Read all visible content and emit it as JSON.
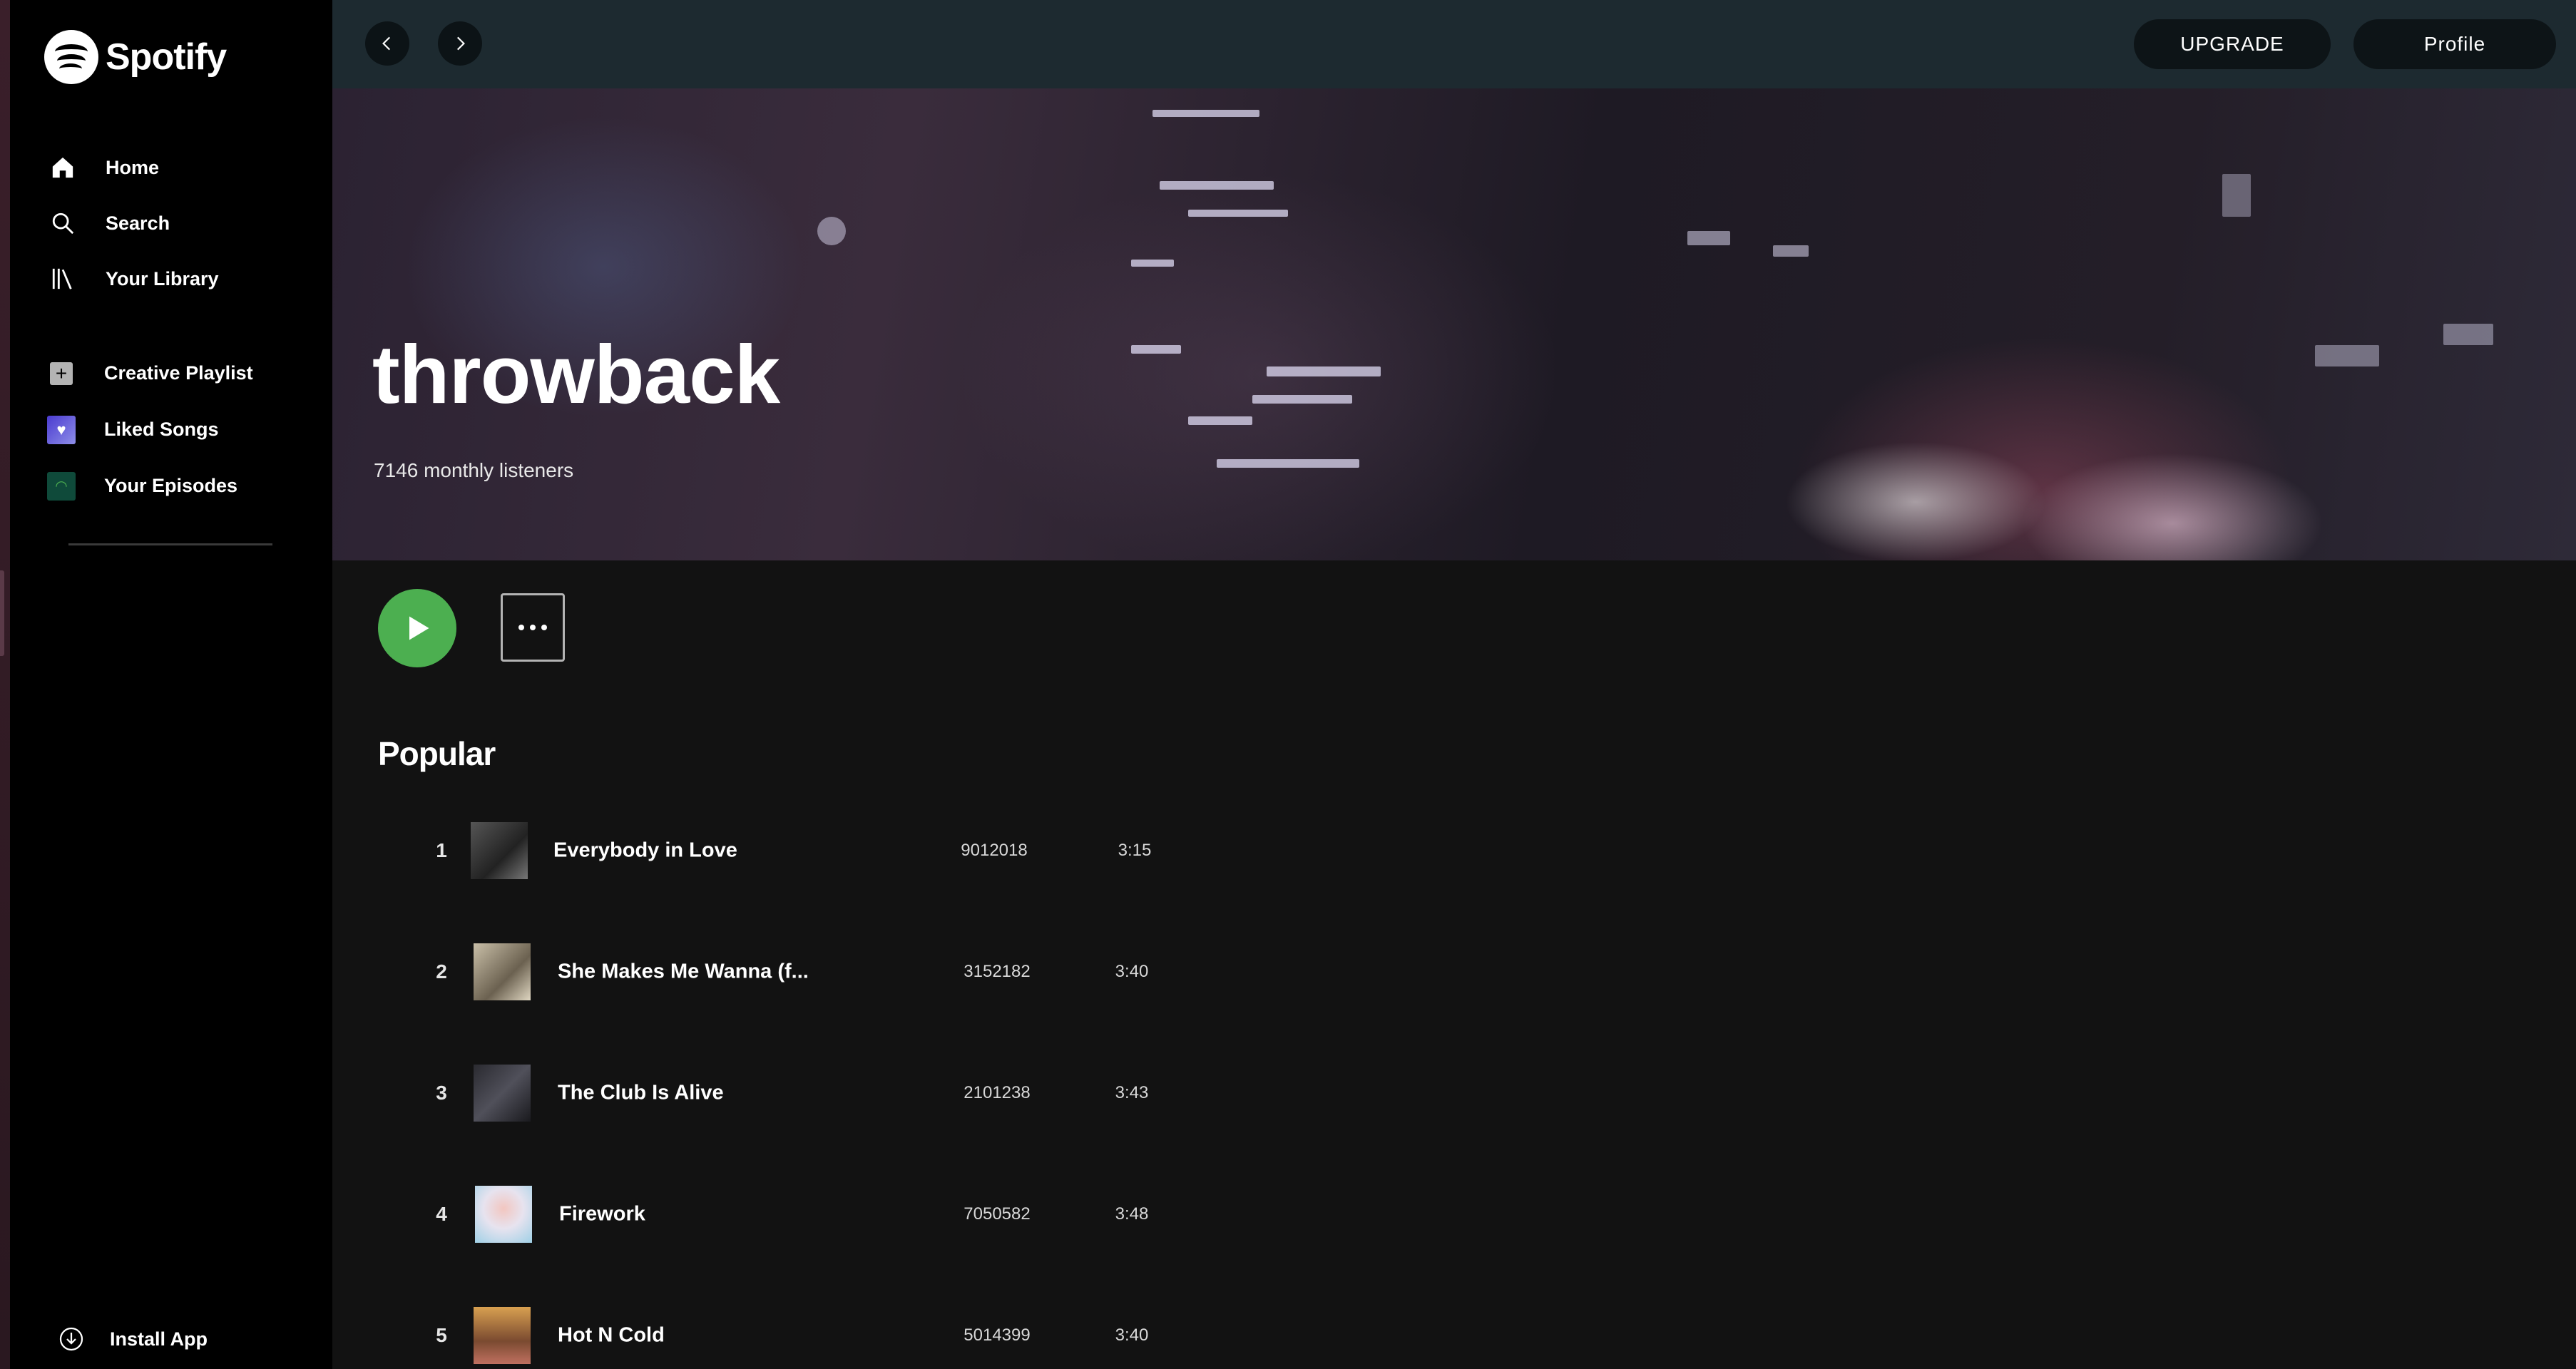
{
  "brand": {
    "name": "Spotify"
  },
  "nav": {
    "items": [
      {
        "label": "Home",
        "icon": "home-icon"
      },
      {
        "label": "Search",
        "icon": "search-icon"
      },
      {
        "label": "Your Library",
        "icon": "library-icon"
      }
    ],
    "secondary": [
      {
        "label": "Creative Playlist",
        "icon": "plus-icon"
      },
      {
        "label": "Liked Songs",
        "icon": "heart-icon"
      },
      {
        "label": "Your Episodes",
        "icon": "podcast-icon"
      }
    ],
    "install_label": "Install App"
  },
  "topbar": {
    "upgrade_label": "UPGRADE",
    "profile_label": "Profile"
  },
  "hero": {
    "title": "throwback",
    "listeners": "7146 monthly listeners"
  },
  "section": {
    "title": "Popular"
  },
  "tracks": [
    {
      "num": "1",
      "title": "Everybody in Love",
      "plays": "9012018",
      "duration": "3:15"
    },
    {
      "num": "2",
      "title": "She Makes Me Wanna (f...",
      "plays": "3152182",
      "duration": "3:40"
    },
    {
      "num": "3",
      "title": "The Club Is Alive",
      "plays": "2101238",
      "duration": "3:43"
    },
    {
      "num": "4",
      "title": "Firework",
      "plays": "7050582",
      "duration": "3:48"
    },
    {
      "num": "5",
      "title": "Hot N Cold",
      "plays": "5014399",
      "duration": "3:40"
    }
  ],
  "colors": {
    "accent_green": "#4caf50",
    "sidebar_bg": "#000000",
    "topbar_bg": "#1d2a30",
    "main_bg": "#121212",
    "liked_songs_tile": "#5a4bd6",
    "episodes_tile": "#0f4a3a"
  }
}
